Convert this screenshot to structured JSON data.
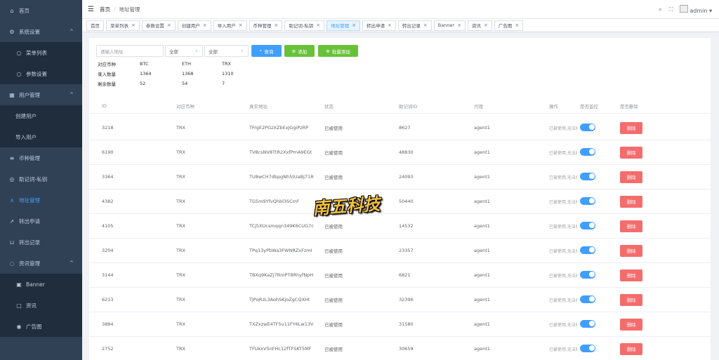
{
  "sidebar": {
    "items": [
      {
        "label": "首页",
        "icon": "home-icon",
        "glyph": "⌂"
      },
      {
        "label": "系统设置",
        "icon": "gear-icon",
        "glyph": "⚙",
        "expanded": true
      },
      {
        "label": "菜单列表",
        "icon": "circle-icon",
        "glyph": "○",
        "sub": true
      },
      {
        "label": "参数设置",
        "icon": "circle-icon",
        "glyph": "○",
        "sub": true
      },
      {
        "label": "用户管理",
        "icon": "user-grid-icon",
        "glyph": "▦",
        "expanded": true
      },
      {
        "label": "创建用户",
        "sub": true
      },
      {
        "label": "导入用户",
        "sub": true
      },
      {
        "label": "币种管理",
        "icon": "sliders-icon",
        "glyph": "≡"
      },
      {
        "label": "助记词-私钥",
        "icon": "target-icon",
        "glyph": "◎"
      },
      {
        "label": "地址管理",
        "icon": "tent-icon",
        "glyph": "∧",
        "active": true
      },
      {
        "label": "转出申请",
        "icon": "rocket-icon",
        "glyph": "➚"
      },
      {
        "label": "转出记录",
        "icon": "cart-icon",
        "glyph": "⊔"
      },
      {
        "label": "资讯管理",
        "icon": "chat-icon",
        "glyph": "◌",
        "expanded": true
      },
      {
        "label": "Banner",
        "icon": "image-icon",
        "glyph": "▣",
        "sub": true
      },
      {
        "label": "资讯",
        "icon": "message-icon",
        "glyph": "▢",
        "sub": true
      },
      {
        "label": "广告图",
        "icon": "eye-icon",
        "glyph": "◉",
        "sub": true
      }
    ]
  },
  "header": {
    "breadcrumb": [
      "首页",
      "地址管理"
    ],
    "user": "admin"
  },
  "tabs": [
    {
      "label": "首页",
      "closable": false
    },
    {
      "label": "菜单列表",
      "closable": true
    },
    {
      "label": "参数设置",
      "closable": true
    },
    {
      "label": "创建用户",
      "closable": true
    },
    {
      "label": "导入用户",
      "closable": true
    },
    {
      "label": "币种管理",
      "closable": true
    },
    {
      "label": "助记词-私钥",
      "closable": true
    },
    {
      "label": "地址管理",
      "closable": true,
      "active": true
    },
    {
      "label": "转出申请",
      "closable": true
    },
    {
      "label": "转出记录",
      "closable": true
    },
    {
      "label": "Banner",
      "closable": true
    },
    {
      "label": "资讯",
      "closable": true
    },
    {
      "label": "广告图",
      "closable": true
    }
  ],
  "filters": {
    "address_placeholder": "请输入地址",
    "select1": "全部",
    "select2": "全部",
    "query_label": "查询",
    "add_label": "添加",
    "batch_add_label": "批量添加"
  },
  "stats": {
    "header": [
      "对应币种",
      "BTC",
      "ETH",
      "TRX"
    ],
    "rows": [
      [
        "录入数量",
        "1364",
        "1368",
        "1310"
      ],
      [
        "剩余数量",
        "52",
        "54",
        "7"
      ]
    ]
  },
  "table": {
    "columns": [
      "ID",
      "对应币种",
      "真实地址",
      "状态",
      "助记词ID",
      "代理",
      "操作",
      "是否监控",
      "是否删除"
    ],
    "op_text": "已被使用,无法修",
    "delete_label": "删除",
    "rows": [
      {
        "id": "3218",
        "currency": "TRX",
        "address": "TFrgE2PGzXZbExJGgiPzRP",
        "status": "已被使用",
        "mnemonic_id": "8627",
        "agent": "agent1",
        "monitored": true
      },
      {
        "id": "6190",
        "currency": "TRX",
        "address": "TV8csNV8TtR2XxfPmA9EGt",
        "status": "已被使用",
        "mnemonic_id": "48830",
        "agent": "agent1",
        "monitored": true
      },
      {
        "id": "3364",
        "currency": "TRX",
        "address": "TU8wCH7dbpgNh5tUaBj71R",
        "status": "已被使用",
        "mnemonic_id": "24093",
        "agent": "agent1",
        "monitored": true
      },
      {
        "id": "4382",
        "currency": "TRX",
        "address": "TG5m9YfvQhbl3SCmf",
        "status": "已被使用",
        "mnemonic_id": "50440",
        "agent": "agent1",
        "monitored": true
      },
      {
        "id": "4105",
        "currency": "TRX",
        "address": "TCj5XUcsmqqn349K6CUG7c",
        "status": "已被使用",
        "mnemonic_id": "14532",
        "agent": "agent1",
        "monitored": true
      },
      {
        "id": "3204",
        "currency": "TRX",
        "address": "TPq13yPbWa3FWNRZxFzmI",
        "status": "已被使用",
        "mnemonic_id": "23357",
        "agent": "agent1",
        "monitored": true
      },
      {
        "id": "3144",
        "currency": "TRX",
        "address": "TBXq9KaZj7RmPT8RhyfNpH",
        "status": "已被使用",
        "mnemonic_id": "6821",
        "agent": "agent1",
        "monitored": true
      },
      {
        "id": "6213",
        "currency": "TRX",
        "address": "TJPqRzL3AohSKjoZgCQXHt",
        "status": "已被使用",
        "mnemonic_id": "32396",
        "agent": "agent1",
        "monitored": true
      },
      {
        "id": "3884",
        "currency": "TRX",
        "address": "TXZxzwE4TF5u11FY6Lw13V",
        "status": "已被使用",
        "mnemonic_id": "31580",
        "agent": "agent1",
        "monitored": true
      },
      {
        "id": "2752",
        "currency": "TRX",
        "address": "TFUkxV5nFHc12fTFSKT5MF",
        "status": "已被使用",
        "mnemonic_id": "30659",
        "agent": "agent1",
        "monitored": true
      }
    ]
  },
  "watermark": "南五科技",
  "colors": {
    "sidebar_bg": "#304156",
    "active": "#409eff",
    "success": "#67c23a",
    "danger": "#f56c6c"
  }
}
